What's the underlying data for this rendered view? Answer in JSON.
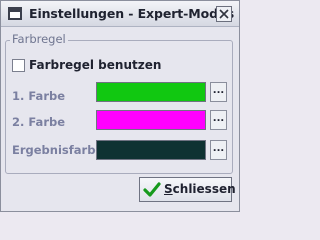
{
  "window": {
    "title": "Einstellungen - Expert-Modus",
    "icon": "window-icon",
    "close_icon": "close-icon"
  },
  "group": {
    "title": "Farbregel",
    "checkbox": {
      "label": "Farbregel benutzen",
      "checked": false
    },
    "rows": [
      {
        "label": "1. Farbe",
        "color": "#11c811",
        "button_label": "..."
      },
      {
        "label": "2. Farbe",
        "color": "#ff00ff",
        "button_label": "..."
      },
      {
        "label": "Ergebnisfarbe",
        "color": "#0e3232",
        "button_label": "..."
      }
    ]
  },
  "footer": {
    "close_button": {
      "mnemonic": "S",
      "rest": "chliessen",
      "icon": "checkmark-icon"
    }
  }
}
